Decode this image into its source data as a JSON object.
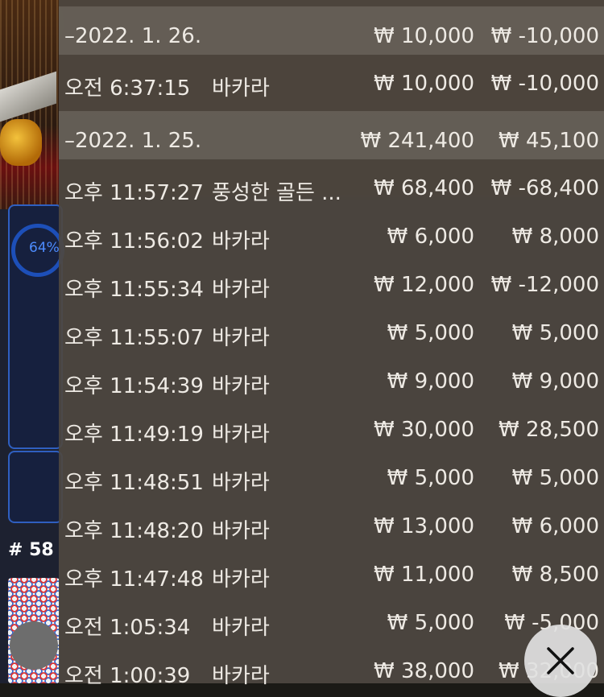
{
  "background": {
    "progress_text": "64%",
    "round_label": "# 58"
  },
  "history": {
    "rows": [
      {
        "type": "date",
        "time": "–2022. 1. 26.",
        "game": "",
        "bet": "₩ 10,000",
        "win": "₩ -10,000"
      },
      {
        "type": "entry",
        "time": "오전 6:37:15",
        "game": "바카라",
        "bet": "₩ 10,000",
        "win": "₩ -10,000"
      },
      {
        "type": "date",
        "time": "–2022. 1. 25.",
        "game": "",
        "bet": "₩ 241,400",
        "win": "₩ 45,100"
      },
      {
        "type": "entry",
        "time": "오후 11:57:27",
        "game": "풍성한 골든 ...",
        "bet": "₩ 68,400",
        "win": "₩ -68,400"
      },
      {
        "type": "entry",
        "time": "오후 11:56:02",
        "game": "바카라",
        "bet": "₩ 6,000",
        "win": "₩ 8,000"
      },
      {
        "type": "entry",
        "time": "오후 11:55:34",
        "game": "바카라",
        "bet": "₩ 12,000",
        "win": "₩ -12,000"
      },
      {
        "type": "entry",
        "time": "오후 11:55:07",
        "game": "바카라",
        "bet": "₩ 5,000",
        "win": "₩ 5,000"
      },
      {
        "type": "entry",
        "time": "오후 11:54:39",
        "game": "바카라",
        "bet": "₩ 9,000",
        "win": "₩ 9,000"
      },
      {
        "type": "entry",
        "time": "오후 11:49:19",
        "game": "바카라",
        "bet": "₩ 30,000",
        "win": "₩ 28,500"
      },
      {
        "type": "entry",
        "time": "오후 11:48:51",
        "game": "바카라",
        "bet": "₩ 5,000",
        "win": "₩ 5,000"
      },
      {
        "type": "entry",
        "time": "오후 11:48:20",
        "game": "바카라",
        "bet": "₩ 13,000",
        "win": "₩ 6,000"
      },
      {
        "type": "entry",
        "time": "오후 11:47:48",
        "game": "바카라",
        "bet": "₩ 11,000",
        "win": "₩ 8,500"
      },
      {
        "type": "entry",
        "time": "오전 1:05:34",
        "game": "바카라",
        "bet": "₩ 5,000",
        "win": "₩ -5,000"
      },
      {
        "type": "entry",
        "time": "오전 1:00:39",
        "game": "바카라",
        "bet": "₩ 38,000",
        "win": "₩ 32,000"
      }
    ]
  },
  "close_button": {
    "icon": "close-icon"
  }
}
